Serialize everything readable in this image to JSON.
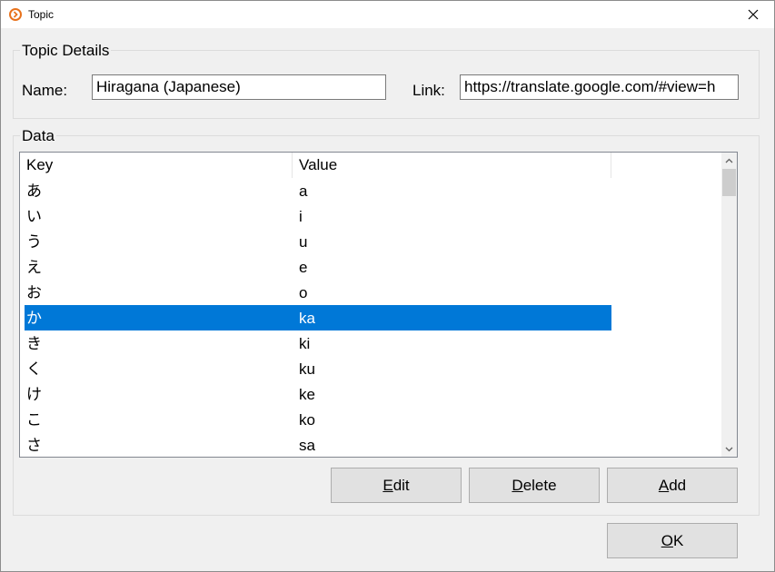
{
  "window": {
    "title": "Topic",
    "close_glyph": "✕",
    "icon": "chevron-circle-icon",
    "accent_color": "#e8721c"
  },
  "topic_details": {
    "group_label": "Topic Details",
    "name_label": "Name:",
    "name_value": "Hiragana (Japanese)",
    "link_label": "Link:",
    "link_value": "https://translate.google.com/#view=h"
  },
  "data": {
    "group_label": "Data",
    "columns": [
      "Key",
      "Value"
    ],
    "rows": [
      {
        "key": "あ",
        "value": "a"
      },
      {
        "key": "い",
        "value": "i"
      },
      {
        "key": "う",
        "value": "u"
      },
      {
        "key": "え",
        "value": "e"
      },
      {
        "key": "お",
        "value": "o"
      },
      {
        "key": "か",
        "value": "ka"
      },
      {
        "key": "き",
        "value": "ki"
      },
      {
        "key": "く",
        "value": "ku"
      },
      {
        "key": "け",
        "value": "ke"
      },
      {
        "key": "こ",
        "value": "ko"
      },
      {
        "key": "さ",
        "value": "sa"
      }
    ],
    "selected_row": 5,
    "selection_color": "#0078d7"
  },
  "buttons": {
    "edit": {
      "mnemonic": "E",
      "rest": "dit"
    },
    "delete": {
      "mnemonic": "D",
      "rest": "elete"
    },
    "add": {
      "mnemonic": "A",
      "rest": "dd"
    },
    "ok": {
      "mnemonic": "O",
      "rest": "K"
    }
  }
}
